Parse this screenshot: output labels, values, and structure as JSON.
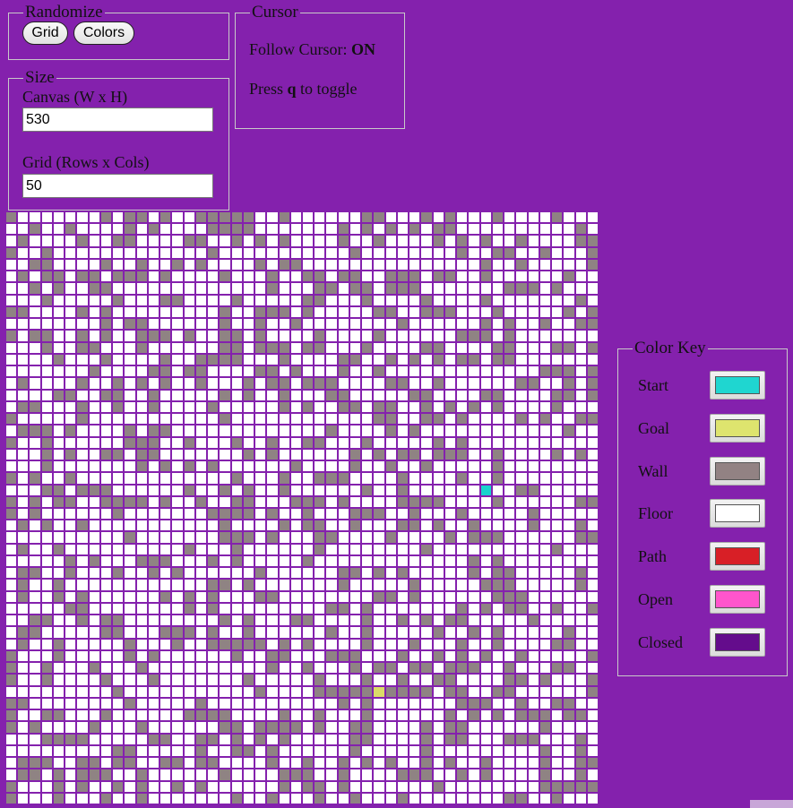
{
  "randomize": {
    "legend": "Randomize",
    "grid_button": "Grid",
    "colors_button": "Colors"
  },
  "cursor": {
    "legend": "Cursor",
    "follow_label": "Follow Cursor:",
    "follow_state": "ON",
    "toggle_prefix": "Press",
    "toggle_key": "q",
    "toggle_suffix": "to toggle"
  },
  "size": {
    "legend": "Size",
    "canvas_label": "Canvas (W x H)",
    "canvas_value": "530",
    "grid_label": "Grid (Rows x Cols)",
    "grid_value": "50"
  },
  "grid": {
    "rows": 50,
    "cols": 50,
    "floor_color": "#ffffff",
    "wall_color": "#8f8383",
    "start_cell": [
      23,
      40
    ],
    "goal_cell": [
      40,
      31
    ],
    "start_color": "#1ad4cc",
    "goal_color": "#dbdb68"
  },
  "color_key": {
    "legend": "Color Key",
    "items": [
      {
        "label": "Start",
        "color": "#1fd6d0"
      },
      {
        "label": "Goal",
        "color": "#dee46e"
      },
      {
        "label": "Wall",
        "color": "#928283"
      },
      {
        "label": "Floor",
        "color": "#ffffff"
      },
      {
        "label": "Path",
        "color": "#d81f26"
      },
      {
        "label": "Open",
        "color": "#ff55cc"
      },
      {
        "label": "Closed",
        "color": "#640c8c"
      }
    ]
  },
  "colors": {
    "background": "#8421ad"
  }
}
